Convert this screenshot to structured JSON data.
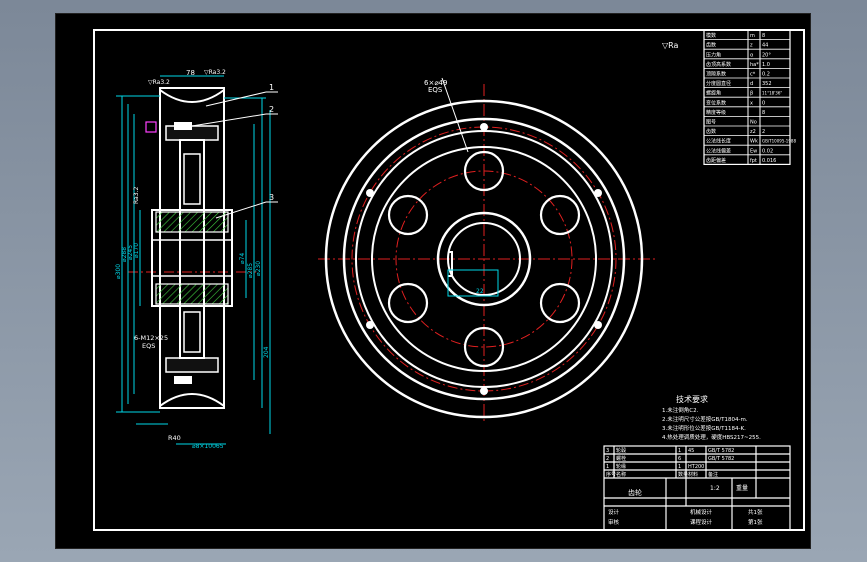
{
  "drawing": {
    "section_view": {
      "top_dims": [
        "78",
        "▽Ra3.2",
        "▽Ra3.2"
      ],
      "balloons": [
        "1",
        "2",
        "3"
      ],
      "left_dims": [
        "⌀300",
        "⌀288",
        "⌀245",
        "⌀170"
      ],
      "right_dims": [
        "⌀74",
        "⌀285",
        "⌀230",
        "204"
      ],
      "left_notes": [
        "Ra3.2",
        "6-M12×25",
        "EQS"
      ],
      "bottom_dims": [
        "R40",
        "⌀8×10065"
      ]
    },
    "front_view": {
      "callout": [
        "6×⌀49",
        "EQS"
      ],
      "keyway_label": "22"
    },
    "surface_symbol": "▽Ra",
    "param_table": {
      "rows": [
        [
          "模数",
          "m",
          "8"
        ],
        [
          "齿数",
          "z",
          "44"
        ],
        [
          "压力角",
          "α",
          "20°"
        ],
        [
          "齿顶高系数",
          "ha*",
          "1.0"
        ],
        [
          "顶隙系数",
          "c*",
          "0.2"
        ],
        [
          "分度圆直径",
          "d",
          "352"
        ],
        [
          "螺旋角",
          "β",
          "11°18'36\""
        ],
        [
          "变位系数",
          "x",
          "0"
        ],
        [
          "精度等级",
          "",
          "8"
        ],
        [
          "图号",
          "No",
          ""
        ],
        [
          "齿数",
          "z2",
          "2"
        ],
        [
          "公法线长度",
          "Wk",
          "GB/T10095-1988"
        ],
        [
          "公法线偏差",
          "Ew",
          "0.02"
        ],
        [
          "齿距偏差",
          "fpt",
          "0.016"
        ]
      ]
    },
    "tech_req": {
      "title": "技术要求",
      "lines": [
        "1.未注倒角C2.",
        "2.未注明尺寸公差按GB/T1804-m.",
        "3.未注明形位公差按GB/T1184-K.",
        "4.热处理调质处理，硬度HBS217~255."
      ]
    },
    "title_block": {
      "bom": [
        [
          "3",
          "轮毂",
          "1",
          "45",
          "GB/T 5782",
          ""
        ],
        [
          "2",
          "螺栓",
          "6",
          "",
          "GB/T 5782",
          ""
        ],
        [
          "1",
          "轮缘",
          "1",
          "HT200",
          "",
          ""
        ]
      ],
      "bom_header": [
        "序号",
        "名称",
        "数量",
        "材料",
        "备注",
        ""
      ],
      "drawing_name": "齿轮",
      "scale": "1:2",
      "weight": "重量",
      "sheets": "共1张",
      "designer": "设计",
      "checker": "审核",
      "school": "机械设计",
      "school2": "课程设计",
      "sheet_no": "第1张"
    }
  }
}
